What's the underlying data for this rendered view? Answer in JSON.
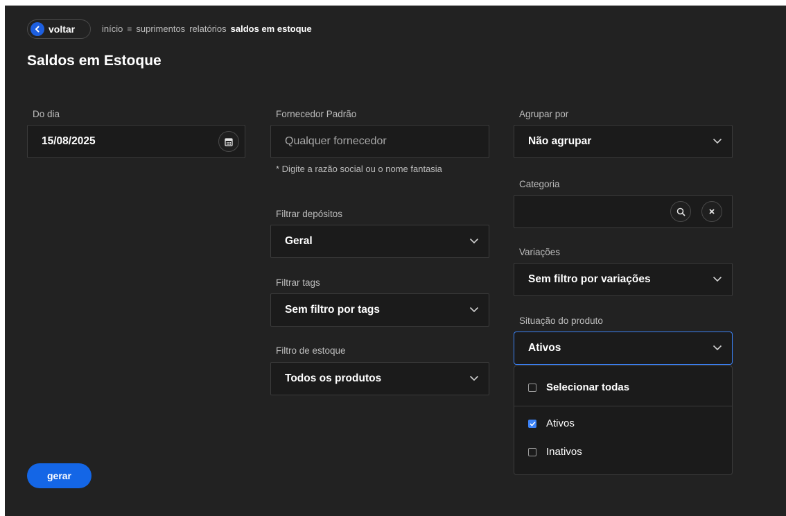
{
  "breadcrumb": {
    "back_label": "voltar",
    "items": [
      "início",
      "suprimentos",
      "relatórios"
    ],
    "current": "saldos em estoque"
  },
  "page_title": "Saldos em Estoque",
  "form": {
    "do_dia": {
      "label": "Do dia",
      "value": "15/08/2025",
      "icon": "calendar-icon"
    },
    "fornecedor": {
      "label": "Fornecedor Padrão",
      "placeholder": "Qualquer fornecedor",
      "hint": "* Digite a razão social ou o nome fantasia"
    },
    "filtrar_depositos": {
      "label": "Filtrar depósitos",
      "value": "Geral"
    },
    "filtrar_tags": {
      "label": "Filtrar tags",
      "value": "Sem filtro por tags"
    },
    "filtro_estoque": {
      "label": "Filtro de estoque",
      "value": "Todos os produtos"
    },
    "agrupar_por": {
      "label": "Agrupar por",
      "value": "Não agrupar"
    },
    "categoria": {
      "label": "Categoria",
      "value": ""
    },
    "variacoes": {
      "label": "Variações",
      "value": "Sem filtro por variações"
    },
    "situacao": {
      "label": "Situação do produto",
      "value": "Ativos",
      "select_all_label": "Selecionar todas",
      "options": [
        {
          "label": "Ativos",
          "checked": true
        },
        {
          "label": "Inativos",
          "checked": false
        }
      ]
    }
  },
  "actions": {
    "gerar_label": "gerar"
  },
  "colors": {
    "background": "#222222",
    "field": "#1b1b1b",
    "accent": "#1466e6",
    "focus": "#3b82f6"
  }
}
